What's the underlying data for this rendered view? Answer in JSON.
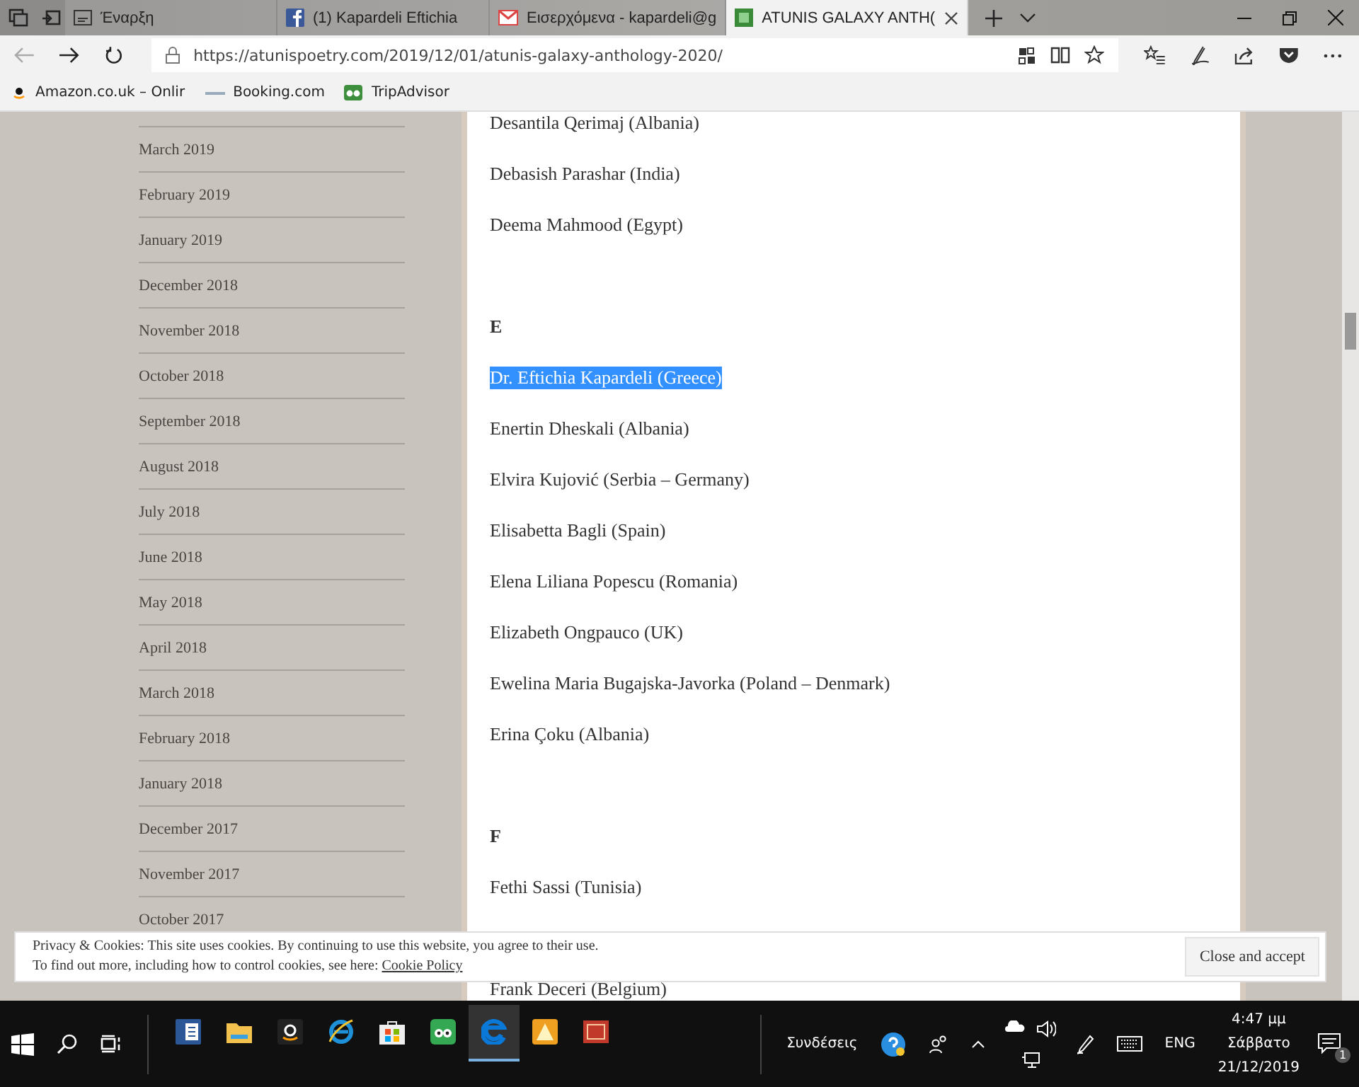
{
  "browser": {
    "tabs": [
      {
        "label": "Έναρξη",
        "kind": "page",
        "selected": false
      },
      {
        "label": "(1) Kapardeli Eftichia",
        "kind": "facebook",
        "selected": false
      },
      {
        "label": "Εισερχόμενα - kapardeli@g",
        "kind": "mail",
        "selected": false
      },
      {
        "label": "ATUNIS GALAXY ANTH(",
        "kind": "site",
        "selected": true
      }
    ],
    "url": "https://atunispoetry.com/2019/12/01/atunis-galaxy-anthology-2020/",
    "favorites": [
      {
        "label": "Amazon.co.uk – Onlir",
        "kind": "amazon"
      },
      {
        "label": "Booking.com",
        "kind": "booking"
      },
      {
        "label": "TripAdvisor",
        "kind": "tripadvisor"
      }
    ]
  },
  "sidebar": {
    "archive": [
      "March 2019",
      "February 2019",
      "January 2019",
      "December 2018",
      "November 2018",
      "October 2018",
      "September 2018",
      "August 2018",
      "July 2018",
      "June 2018",
      "May 2018",
      "April 2018",
      "March 2018",
      "February 2018",
      "January 2018",
      "December 2017",
      "November 2017",
      "October 2017"
    ]
  },
  "content": {
    "items": [
      {
        "kind": "name",
        "text": "Desantila Qerimaj (Albania)"
      },
      {
        "kind": "name",
        "text": "Debasish Parashar (India)"
      },
      {
        "kind": "name",
        "text": "Deema Mahmood (Egypt)"
      },
      {
        "kind": "letter",
        "text": "E"
      },
      {
        "kind": "name",
        "text": "Dr. Eftichia Kapardeli (Greece)",
        "highlighted": true
      },
      {
        "kind": "name",
        "text": "Enertin Dheskali (Albania)"
      },
      {
        "kind": "name",
        "text": "Elvira Kujović (Serbia – Germany)"
      },
      {
        "kind": "name",
        "text": "Elisabetta Bagli (Spain)"
      },
      {
        "kind": "name",
        "text": "Elena Liliana Popescu (Romania)"
      },
      {
        "kind": "name",
        "text": "Elizabeth Ongpauco (UK)"
      },
      {
        "kind": "name",
        "text": "Ewelina Maria Bugajska-Javorka (Poland – Denmark)"
      },
      {
        "kind": "name",
        "text": "Erina Çoku (Albania)"
      },
      {
        "kind": "letter",
        "text": "F"
      },
      {
        "kind": "name",
        "text": "Fethi Sassi (Tunisia)"
      },
      {
        "kind": "covered"
      },
      {
        "kind": "name",
        "text": "Frank Deceri (Belgium)"
      }
    ]
  },
  "cookie_banner": {
    "line_1": "Privacy & Cookies: This site uses cookies. By continuing to use this website, you agree to their use.",
    "line_2": "To find out more, including how to control cookies, see here:",
    "link": "Cookie Policy",
    "button": "Close and accept"
  },
  "taskbar": {
    "apps": [
      {
        "kind": "word",
        "active": false
      },
      {
        "kind": "folder",
        "active": false
      },
      {
        "kind": "amazon",
        "active": false
      },
      {
        "kind": "ie",
        "active": false
      },
      {
        "kind": "store",
        "active": false
      },
      {
        "kind": "tripadvisor",
        "active": false
      },
      {
        "kind": "edge",
        "active": true
      },
      {
        "kind": "orange",
        "active": false
      },
      {
        "kind": "red",
        "active": false
      }
    ],
    "connections": "Συνδέσεις",
    "language": "ENG",
    "time": "4:47 μμ",
    "day": "Σάββατο",
    "date": "21/12/2019",
    "notifications": "1"
  }
}
